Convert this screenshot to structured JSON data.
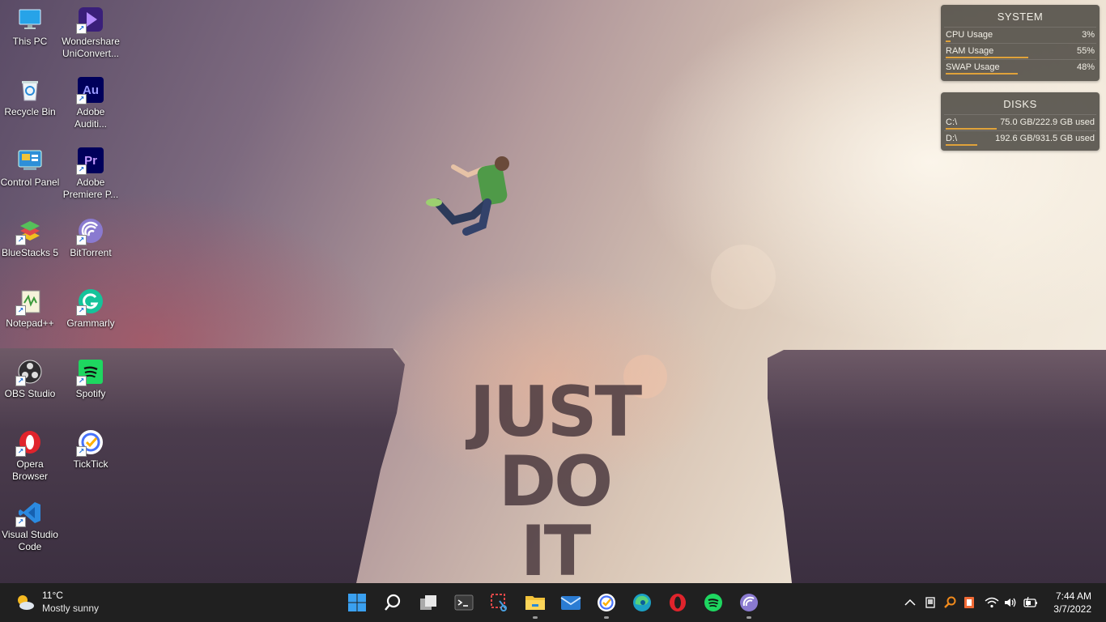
{
  "wallpaper": {
    "slogan_line1": "JUST",
    "slogan_line2": "DO",
    "slogan_line3": "IT"
  },
  "desktop_icons": [
    {
      "id": "this-pc",
      "label": "This PC",
      "icon": "monitor-icon"
    },
    {
      "id": "wondershare",
      "label": "Wondershare UniConvert...",
      "icon": "wondershare-icon"
    },
    {
      "id": "recycle-bin",
      "label": "Recycle Bin",
      "icon": "recycle-bin-icon"
    },
    {
      "id": "audition",
      "label": "Adobe Auditi...",
      "icon": "adobe-audition-icon"
    },
    {
      "id": "control-panel",
      "label": "Control Panel",
      "icon": "control-panel-icon"
    },
    {
      "id": "premiere",
      "label": "Adobe Premiere P...",
      "icon": "adobe-premiere-icon"
    },
    {
      "id": "bluestacks",
      "label": "BlueStacks 5",
      "icon": "bluestacks-icon"
    },
    {
      "id": "bittorrent",
      "label": "BitTorrent",
      "icon": "bittorrent-icon"
    },
    {
      "id": "notepadpp",
      "label": "Notepad++",
      "icon": "notepad-plus-plus-icon"
    },
    {
      "id": "grammarly",
      "label": "Grammarly",
      "icon": "grammarly-icon"
    },
    {
      "id": "obs",
      "label": "OBS Studio",
      "icon": "obs-studio-icon"
    },
    {
      "id": "spotify",
      "label": "Spotify",
      "icon": "spotify-icon"
    },
    {
      "id": "opera",
      "label": "Opera Browser",
      "icon": "opera-icon"
    },
    {
      "id": "ticktick",
      "label": "TickTick",
      "icon": "ticktick-icon"
    },
    {
      "id": "vscode",
      "label": "Visual Studio Code",
      "icon": "vscode-icon"
    }
  ],
  "system_widget": {
    "title": "SYSTEM",
    "rows": [
      {
        "label": "CPU Usage",
        "value": "3%",
        "percent": 3
      },
      {
        "label": "RAM Usage",
        "value": "55%",
        "percent": 55
      },
      {
        "label": "SWAP Usage",
        "value": "48%",
        "percent": 48
      }
    ]
  },
  "disks_widget": {
    "title": "DISKS",
    "rows": [
      {
        "label": "C:\\",
        "value": "75.0 GB/222.9 GB used",
        "percent": 34
      },
      {
        "label": "D:\\",
        "value": "192.6 GB/931.5 GB used",
        "percent": 21
      }
    ]
  },
  "taskbar": {
    "weather": {
      "temp": "11°C",
      "condition": "Mostly sunny"
    },
    "apps": [
      {
        "name": "start",
        "icon": "windows-start-icon",
        "running": false
      },
      {
        "name": "search",
        "icon": "search-icon",
        "running": false
      },
      {
        "name": "task-view",
        "icon": "task-view-icon",
        "running": false
      },
      {
        "name": "terminal",
        "icon": "terminal-icon",
        "running": false
      },
      {
        "name": "snipping-tool",
        "icon": "snipping-tool-icon",
        "running": false
      },
      {
        "name": "file-explorer",
        "icon": "folder-icon",
        "running": true
      },
      {
        "name": "mail",
        "icon": "mail-icon",
        "running": false
      },
      {
        "name": "ticktick",
        "icon": "ticktick-icon",
        "running": true
      },
      {
        "name": "edge",
        "icon": "edge-icon",
        "running": false
      },
      {
        "name": "opera",
        "icon": "opera-icon",
        "running": false
      },
      {
        "name": "spotify",
        "icon": "spotify-icon",
        "running": false
      },
      {
        "name": "bittorrent",
        "icon": "bittorrent-icon",
        "running": true
      }
    ],
    "clock": {
      "time": "7:44 AM",
      "date": "3/7/2022"
    }
  }
}
